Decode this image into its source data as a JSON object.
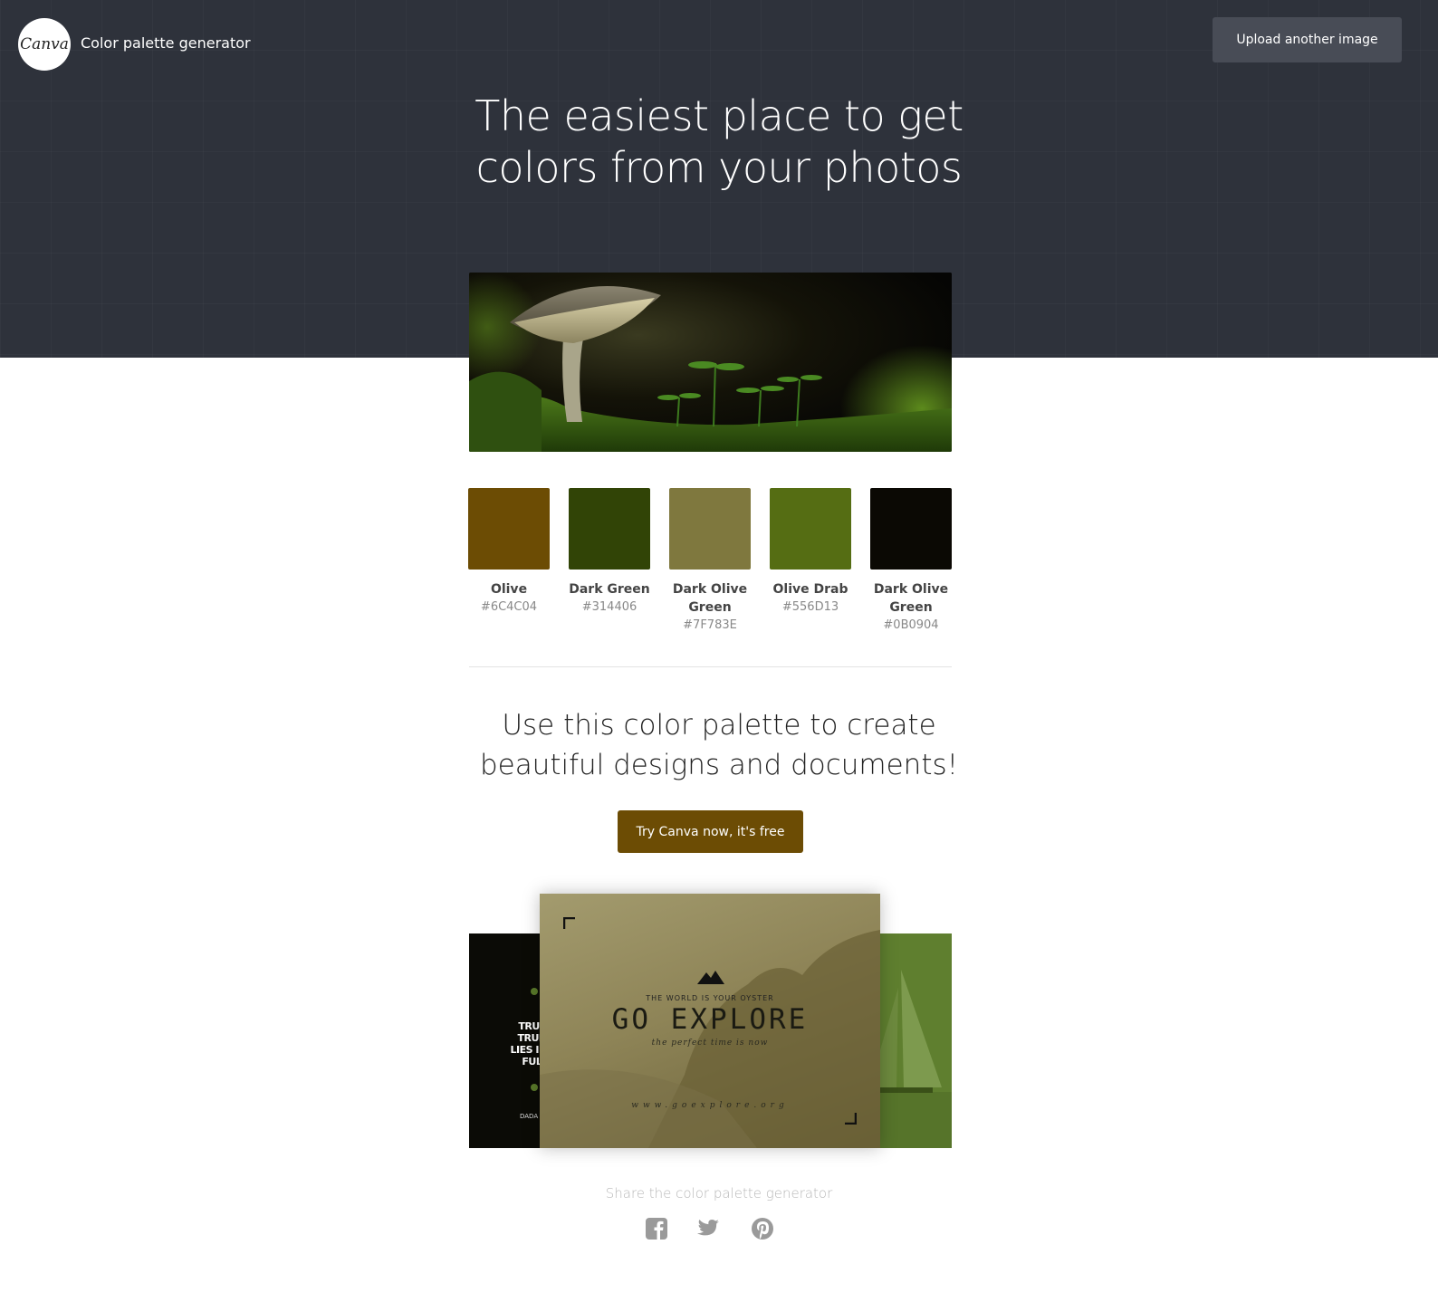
{
  "header": {
    "logo_text": "Canva",
    "app_title": "Color palette generator",
    "upload_label": "Upload another image"
  },
  "hero": {
    "headline_line1": "The easiest place to get",
    "headline_line2": "colors from your photos"
  },
  "palette": [
    {
      "name": "Olive",
      "hex": "#6C4C04",
      "color": "#6C4C04"
    },
    {
      "name": "Dark Green",
      "hex": "#314406",
      "color": "#314406"
    },
    {
      "name": "Dark Olive Green",
      "hex": "#7F783E",
      "color": "#7F783E"
    },
    {
      "name": "Olive Drab",
      "hex": "#556D13",
      "color": "#556D13"
    },
    {
      "name": "Dark Olive Green",
      "hex": "#0B0904",
      "color": "#0B0904"
    }
  ],
  "cta": {
    "line1": "Use this color palette to create",
    "line2": "beautiful designs and documents!",
    "button_label": "Try Canva now, it's free"
  },
  "examples": {
    "left_quote": "TRUE SU\nTRUE HA\nLIES IN FR\nFULFILL",
    "left_author": "DADA V",
    "main_tagline": "THE WORLD IS YOUR OYSTER",
    "main_title": "GO EXPLORE",
    "main_subtitle": "the perfect time is now",
    "main_url": "www.goexplore.org"
  },
  "share": {
    "label": "Share the color palette generator",
    "icons": [
      "facebook-icon",
      "twitter-icon",
      "pinterest-icon"
    ]
  },
  "colors": {
    "hero_bg": "#2E323B",
    "upload_btn_bg": "#484C56",
    "cta_btn_bg": "#6C4C04"
  }
}
